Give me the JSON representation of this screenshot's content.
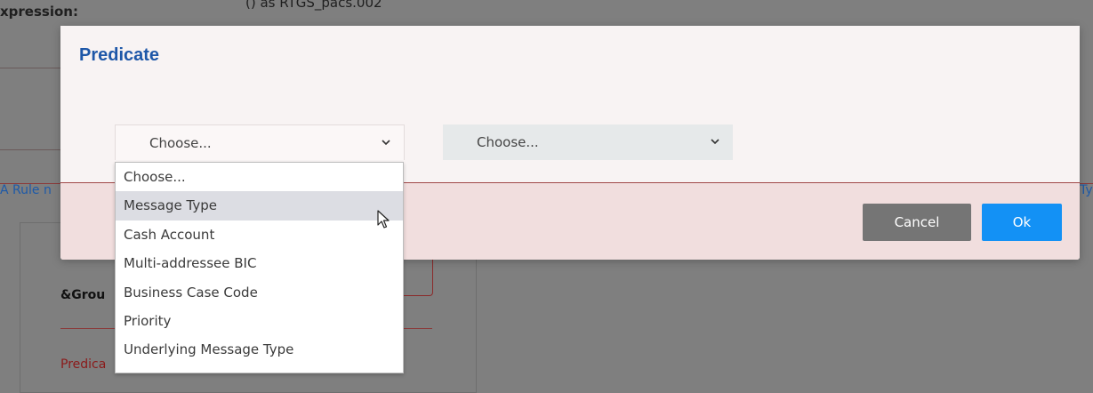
{
  "background": {
    "expression_label": "xpression:",
    "expression_value": "() as RTGS_pacs.002",
    "link_left": "A Rule n",
    "link_right": "Ty",
    "group_label": "&Grou",
    "predicate_label": "Predica"
  },
  "modal": {
    "title": "Predicate",
    "select_1": {
      "value": "Choose..."
    },
    "select_2": {
      "value": "Choose..."
    },
    "cancel_label": "Cancel",
    "ok_label": "Ok"
  },
  "dropdown": {
    "options": [
      "Choose...",
      "Message Type",
      "Cash Account",
      "Multi-addressee BIC",
      "Business Case Code",
      "Priority",
      "Underlying Message Type"
    ],
    "highlighted": "Message Type"
  },
  "icons": {
    "chevron": "chevron-down-icon",
    "cursor": "mouse-pointer-icon"
  },
  "colors": {
    "title": "#1e57a8",
    "ok": "#1391f5",
    "cancel": "#757575",
    "divider": "#a04848"
  }
}
